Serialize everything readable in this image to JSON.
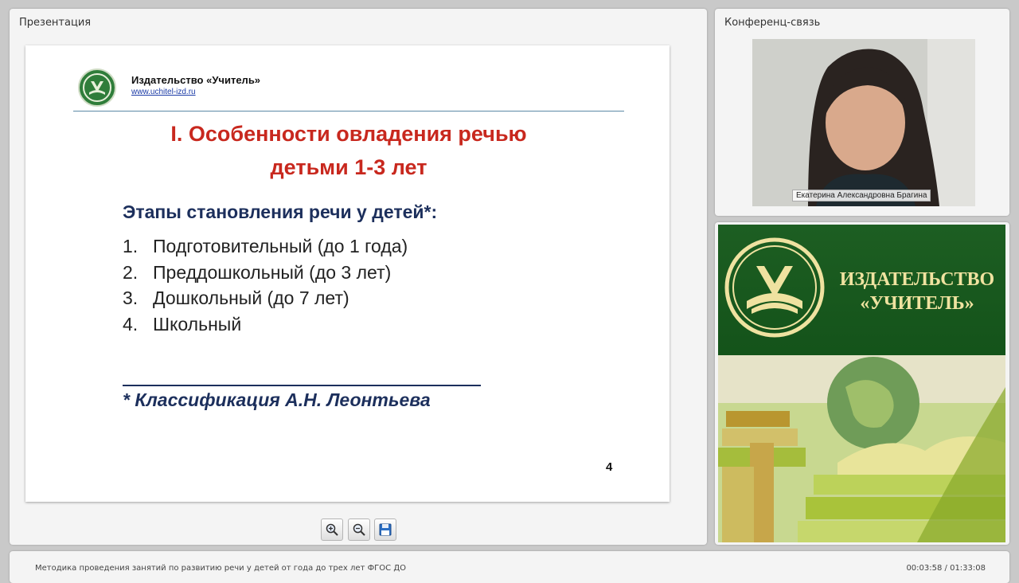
{
  "presentation_panel": {
    "title": "Презентация"
  },
  "slide": {
    "publisher_name": "Издательство «Учитель»",
    "publisher_url": "www.uchitel-izd.ru",
    "title_line1": "I. Особенности овладения речью",
    "title_line2": "детьми 1-3 лет",
    "subtitle": "Этапы становления речи у детей*:",
    "stages": [
      {
        "num": "1.",
        "text": "Подготовительный (до 1 года)"
      },
      {
        "num": "2.",
        "text": "Преддошкольный (до 3 лет)"
      },
      {
        "num": "3.",
        "text": "Дошкольный (до 7 лет)"
      },
      {
        "num": "4.",
        "text": "Школьный"
      }
    ],
    "footnote": "* Классификация А.Н. Леонтьева",
    "page_number": "4"
  },
  "toolbar": {
    "icons": [
      "zoom-in-icon",
      "zoom-out-icon",
      "save-icon"
    ]
  },
  "conference_panel": {
    "title": "Конференц-связь",
    "speaker_name": "Екатерина Александровна Брагина"
  },
  "ad_panel": {
    "title_line1": "ИЗДАТЕЛЬСТВО",
    "title_line2": "«УЧИТЕЛЬ»"
  },
  "bottom_bar": {
    "course_title": "Методика проведения занятий  по развитию речи у детей от года до трех лет ФГОС ДО",
    "timecode": "00:03:58 / 01:33:08"
  },
  "colors": {
    "slide_title": "#c8281e",
    "slide_text_dark_blue": "#1c2f5c",
    "ad_green": "#1d5e22",
    "ad_gold": "#f0e3a0"
  }
}
